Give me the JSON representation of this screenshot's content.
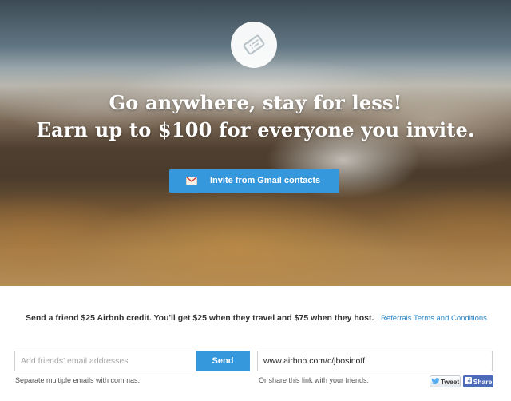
{
  "hero": {
    "icon": "ticket-icon",
    "title_line1": "Go anywhere, stay for less!",
    "title_line2": "Earn up to $100 for everyone you invite.",
    "gmail_button": {
      "icon": "envelope-icon",
      "label": "Invite from Gmail contacts"
    }
  },
  "referral": {
    "promo_text": "Send a friend $25 Airbnb credit. You'll get $25 when they travel and $75 when they host.",
    "terms_link": "Referrals Terms and Conditions",
    "email_input": {
      "placeholder": "Add friends' email addresses",
      "value": ""
    },
    "send_label": "Send",
    "email_help": "Separate multiple emails with commas.",
    "share_link": "www.airbnb.com/c/jbosinoff",
    "link_help": "Or share this link with your friends.",
    "tweet_label": "Tweet",
    "share_label": "Share"
  },
  "colors": {
    "accent": "#3598dc",
    "link": "#2a84c4",
    "facebook": "#4c69ba"
  }
}
